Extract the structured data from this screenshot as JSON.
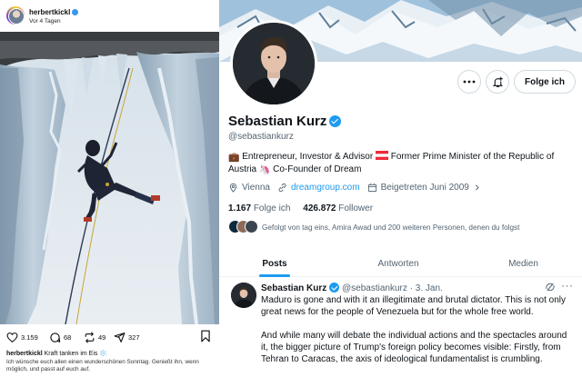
{
  "instagram": {
    "username": "herbertkickl",
    "time_ago": "Vor 4 Tagen",
    "actions": {
      "likes": "3.159",
      "comments": "68",
      "reposts": "49",
      "shares": "327"
    },
    "caption_user": "herbertkickl",
    "caption_text": "Kraft tanken im Eis ❄️",
    "comment_text": "Ich wünsche euch allen einen wunderschönen Sonntag. Genießt ihn, wenn möglich, und passt auf euch auf.",
    "icons": [
      "heart-icon",
      "comment-icon",
      "repost-icon",
      "share-icon",
      "bookmark-icon"
    ]
  },
  "x_profile": {
    "name": "Sebastian Kurz",
    "handle": "@sebastiankurz",
    "follow_label": "Folge ich",
    "bio": {
      "emoji_briefcase": "💼",
      "part1": "Entrepreneur, Investor & Advisor",
      "part2": "Former Prime Minister of the Republic of Austria",
      "emoji_unicorn": "🦄",
      "part3": "Co-Founder of Dream"
    },
    "location": "Vienna",
    "website": "dreamgroup.com",
    "joined": "Beigetreten Juni 2009",
    "following_count": "1.167",
    "following_label": "Folge ich",
    "followers_count": "426.872",
    "followers_label": "Follower",
    "followed_by_text": "Gefolgt von tag eins, Amira Awad und 200 weiteren Personen, denen du folgst",
    "tabs": [
      "Posts",
      "Antworten",
      "Medien"
    ],
    "active_tab": "Posts",
    "accent_color": "#1d9bf0",
    "tweet": {
      "name": "Sebastian Kurz",
      "handle": "@sebastiankurz",
      "separator": "·",
      "date": "3. Jan.",
      "more": "···",
      "paragraph1": "Maduro is gone and with it an illegitimate and brutal dictator. This is not only great news for the people of Venezuela but for the whole free world.",
      "paragraph2": "And while many will debate the individual actions and the spectacles around it, the bigger picture of Trump's foreign policy becomes visible: Firstly, from Tehran to Caracas, the axis of ideological fundamentalist is crumbling."
    }
  }
}
